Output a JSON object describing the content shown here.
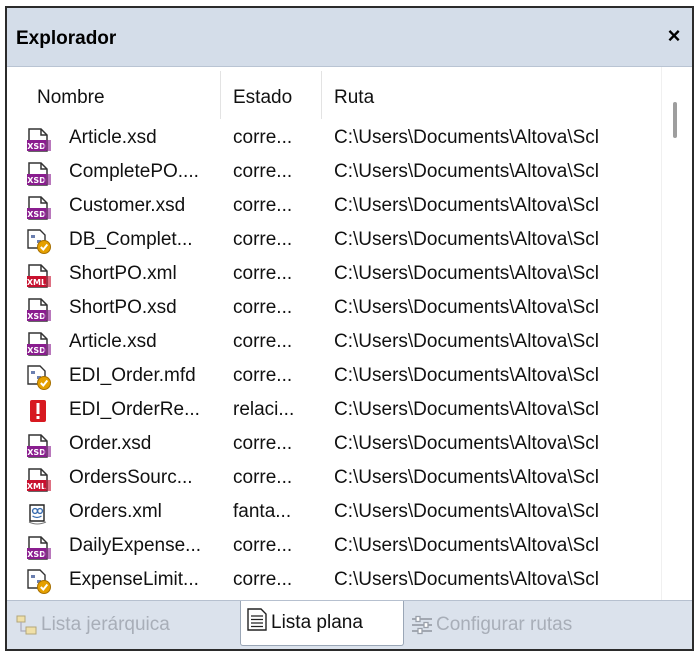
{
  "panel": {
    "title": "Explorador",
    "close_symbol": "×"
  },
  "columns": {
    "name": "Nombre",
    "status": "Estado",
    "path": "Ruta"
  },
  "rows": [
    {
      "icon": "xsd-file-icon",
      "name": "Article.xsd",
      "status": "corre...",
      "path": "C:\\Users\\Documents\\Altova\\Scl"
    },
    {
      "icon": "xsd-file-icon",
      "name": "CompletePO....",
      "status": "corre...",
      "path": "C:\\Users\\Documents\\Altova\\Scl"
    },
    {
      "icon": "xsd-file-icon",
      "name": "Customer.xsd",
      "status": "corre...",
      "path": "C:\\Users\\Documents\\Altova\\Scl"
    },
    {
      "icon": "mapping-file-icon",
      "name": "DB_Complet...",
      "status": "corre...",
      "path": "C:\\Users\\Documents\\Altova\\Scl"
    },
    {
      "icon": "xml-file-icon",
      "name": "ShortPO.xml",
      "status": "corre...",
      "path": "C:\\Users\\Documents\\Altova\\Scl"
    },
    {
      "icon": "xsd-file-icon",
      "name": "ShortPO.xsd",
      "status": "corre...",
      "path": "C:\\Users\\Documents\\Altova\\Scl"
    },
    {
      "icon": "xsd-file-icon",
      "name": "Article.xsd",
      "status": "corre...",
      "path": "C:\\Users\\Documents\\Altova\\Scl"
    },
    {
      "icon": "mapping-file-icon",
      "name": "EDI_Order.mfd",
      "status": "corre...",
      "path": "C:\\Users\\Documents\\Altova\\Scl"
    },
    {
      "icon": "error-icon",
      "name": "EDI_OrderRe...",
      "status": "relaci...",
      "path": "C:\\Users\\Documents\\Altova\\Scl"
    },
    {
      "icon": "xsd-file-icon",
      "name": "Order.xsd",
      "status": "corre...",
      "path": "C:\\Users\\Documents\\Altova\\Scl"
    },
    {
      "icon": "xml-file-icon",
      "name": "OrdersSourc...",
      "status": "corre...",
      "path": "C:\\Users\\Documents\\Altova\\Scl"
    },
    {
      "icon": "ghost-file-icon",
      "name": "Orders.xml",
      "status": "fanta...",
      "path": "C:\\Users\\Documents\\Altova\\Scl"
    },
    {
      "icon": "xsd-file-icon",
      "name": "DailyExpense...",
      "status": "corre...",
      "path": "C:\\Users\\Documents\\Altova\\Scl"
    },
    {
      "icon": "mapping-file-icon",
      "name": "ExpenseLimit...",
      "status": "corre...",
      "path": "C:\\Users\\Documents\\Altova\\Scl"
    }
  ],
  "tabs": [
    {
      "label": "Lista jerárquica",
      "icon": "tree-list-icon",
      "active": false
    },
    {
      "label": "Lista plana",
      "icon": "flat-list-icon",
      "active": true
    },
    {
      "label": "Configurar rutas",
      "icon": "configure-paths-icon",
      "active": false
    }
  ],
  "colors": {
    "title_bar": "#d4dde9",
    "tab_bar": "#dbe2ec",
    "xsd_icon": "#8a1d8f",
    "xml_icon": "#c8102e",
    "mapping_icon": "#e5a000",
    "error_icon": "#d71920"
  }
}
